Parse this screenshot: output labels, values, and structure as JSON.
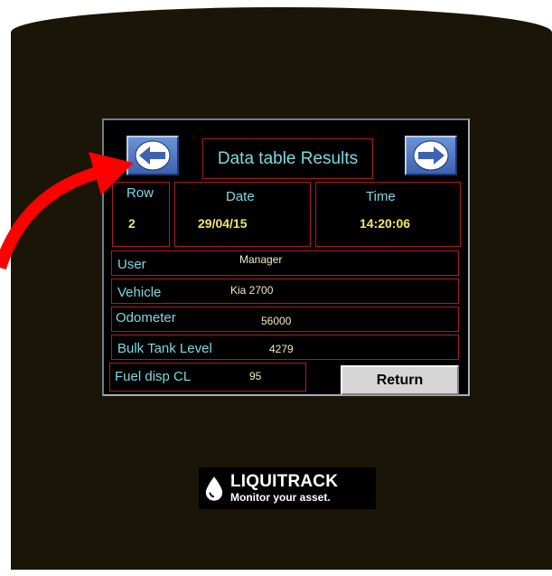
{
  "screen": {
    "title": "Data table Results",
    "nav": {
      "prev_icon": "arrow-left-icon",
      "next_icon": "arrow-right-icon"
    },
    "row": {
      "label": "Row",
      "value": "2"
    },
    "date": {
      "label": "Date",
      "value": "29/04/15"
    },
    "time": {
      "label": "Time",
      "value": "14:20:06"
    },
    "fields": [
      {
        "label": "User",
        "value": "Manager"
      },
      {
        "label": "Vehicle",
        "value": "Kia 2700"
      },
      {
        "label": "Odometer",
        "value": "56000"
      },
      {
        "label": "Bulk Tank Level",
        "value": "4279"
      }
    ],
    "fuel": {
      "label": "Fuel disp CL",
      "value": "95"
    },
    "return_label": "Return"
  },
  "logo": {
    "brand": "LIQUITRACK",
    "tagline": "Monitor your asset.",
    "icon": "droplet-icon"
  },
  "annotation": {
    "icon": "curved-red-arrow-icon",
    "color": "#ff0000"
  },
  "colors": {
    "label_text": "#7fd8e0",
    "value_text": "#f2e56a",
    "border": "#b11a1a",
    "nav_button": "#4a72c4"
  }
}
